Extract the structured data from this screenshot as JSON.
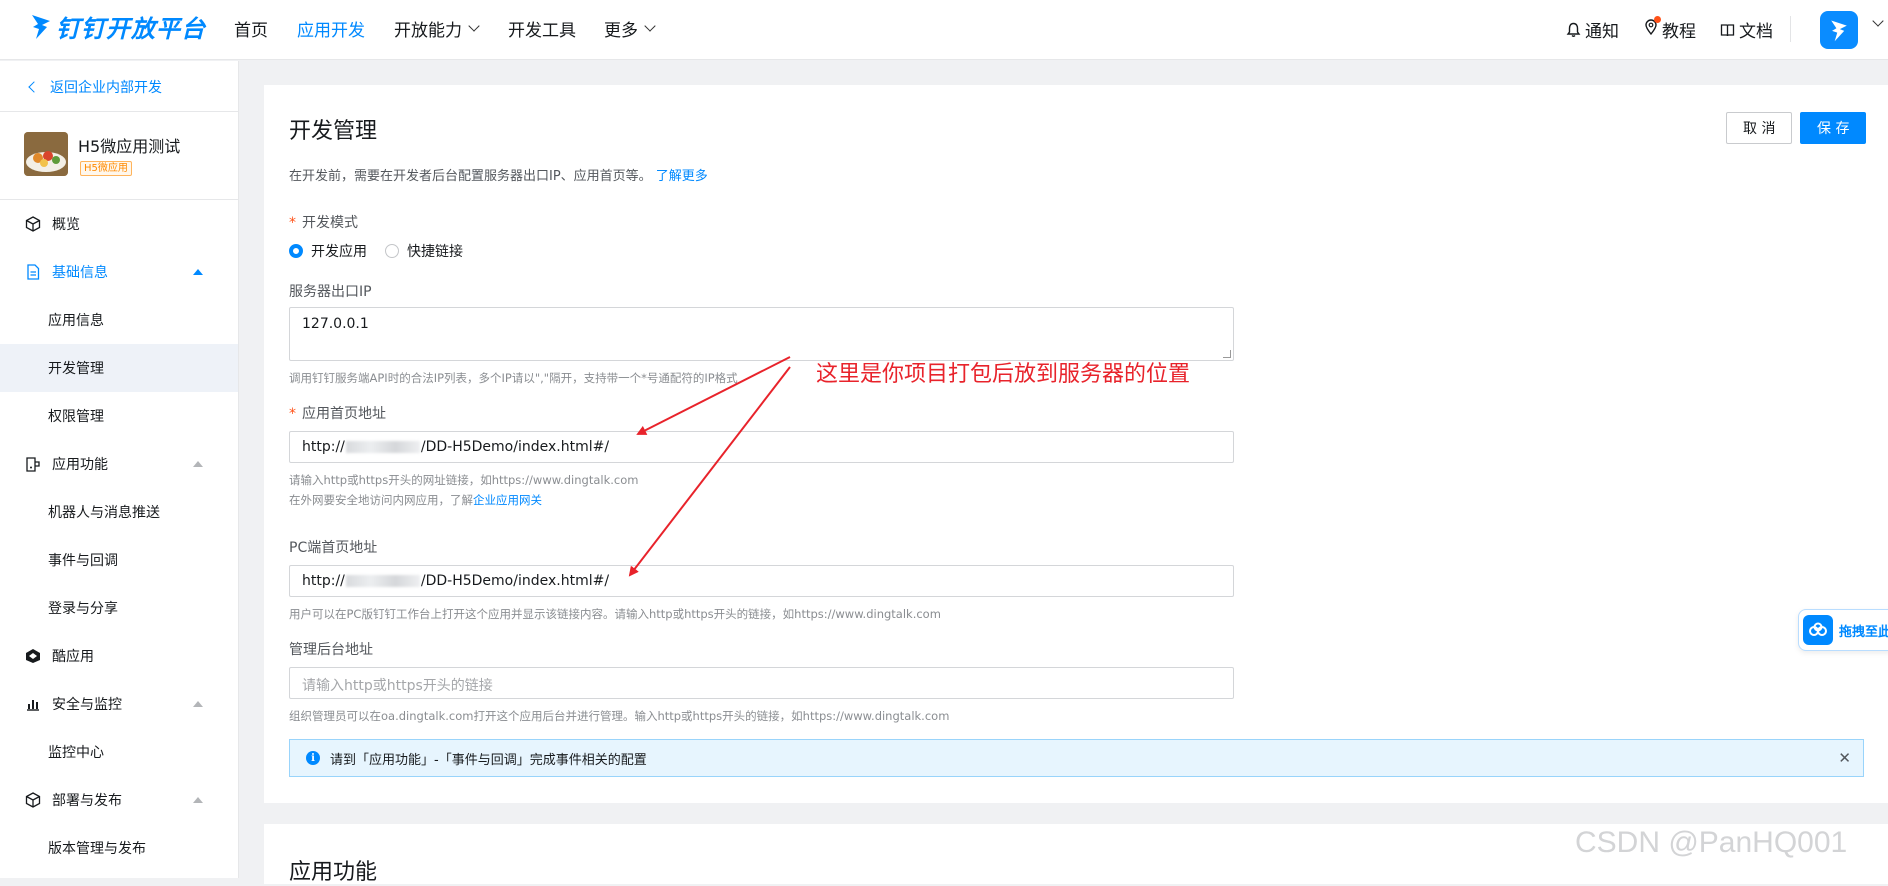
{
  "topnav": {
    "logo": "钉钉开放平台",
    "items": [
      "首页",
      "应用开发",
      "开放能力",
      "开发工具",
      "更多"
    ],
    "right": {
      "notify": "通知",
      "tutorial": "教程",
      "docs": "文档"
    }
  },
  "sidebar": {
    "back": "返回企业内部开发",
    "app_name": "H5微应用测试",
    "app_tag": "H5微应用",
    "menu": [
      {
        "label": "概览"
      },
      {
        "label": "基础信息"
      },
      {
        "label": "应用信息"
      },
      {
        "label": "开发管理"
      },
      {
        "label": "权限管理"
      },
      {
        "label": "应用功能"
      },
      {
        "label": "机器人与消息推送"
      },
      {
        "label": "事件与回调"
      },
      {
        "label": "登录与分享"
      },
      {
        "label": "酷应用"
      },
      {
        "label": "安全与监控"
      },
      {
        "label": "监控中心"
      },
      {
        "label": "部署与发布"
      },
      {
        "label": "版本管理与发布"
      }
    ]
  },
  "main": {
    "title": "开发管理",
    "cancel": "取 消",
    "save": "保 存",
    "desc": "在开发前，需要在开发者后台配置服务器出口IP、应用首页等。",
    "desc_link": "了解更多",
    "dev_mode_label": "开发模式",
    "radio_dev_app": "开发应用",
    "radio_quick_link": "快捷链接",
    "server_ip_label": "服务器出口IP",
    "server_ip_value": "127.0.0.1",
    "server_ip_hint": "调用钉钉服务端API时的合法IP列表，多个IP请以\",\"隔开，支持带一个*号通配符的IP格式",
    "home_url_label": "应用首页地址",
    "home_url_prefix": "http://",
    "home_url_suffix": "/DD-H5Demo/index.html#/",
    "home_url_hint1": "请输入http或https开头的网址链接，如https://www.dingtalk.com",
    "home_url_hint2": "在外网要安全地访问内网应用，了解",
    "home_url_hint2_link": "企业应用网关",
    "pc_url_label": "PC端首页地址",
    "pc_url_prefix": "http://",
    "pc_url_suffix": "/DD-H5Demo/index.html#/",
    "pc_url_hint": "用户可以在PC版钉钉工作台上打开这个应用并显示该链接内容。请输入http或https开头的链接，如https://www.dingtalk.com",
    "admin_url_label": "管理后台地址",
    "admin_url_placeholder": "请输入http或https开头的链接",
    "admin_url_hint": "组织管理员可以在oa.dingtalk.com打开这个应用后台并进行管理。输入http或https开头的链接，如https://www.dingtalk.com",
    "notice": "请到「应用功能」-「事件与回调」完成事件相关的配置",
    "section2_title": "应用功能"
  },
  "annotation": "这里是你项目打包后放到服务器的位置",
  "drag_widget": "拖拽至此",
  "watermark": "CSDN @PanHQ001",
  "colors": {
    "accent": "#0089ff",
    "annotation": "#e8232b",
    "required": "#ff5219"
  }
}
